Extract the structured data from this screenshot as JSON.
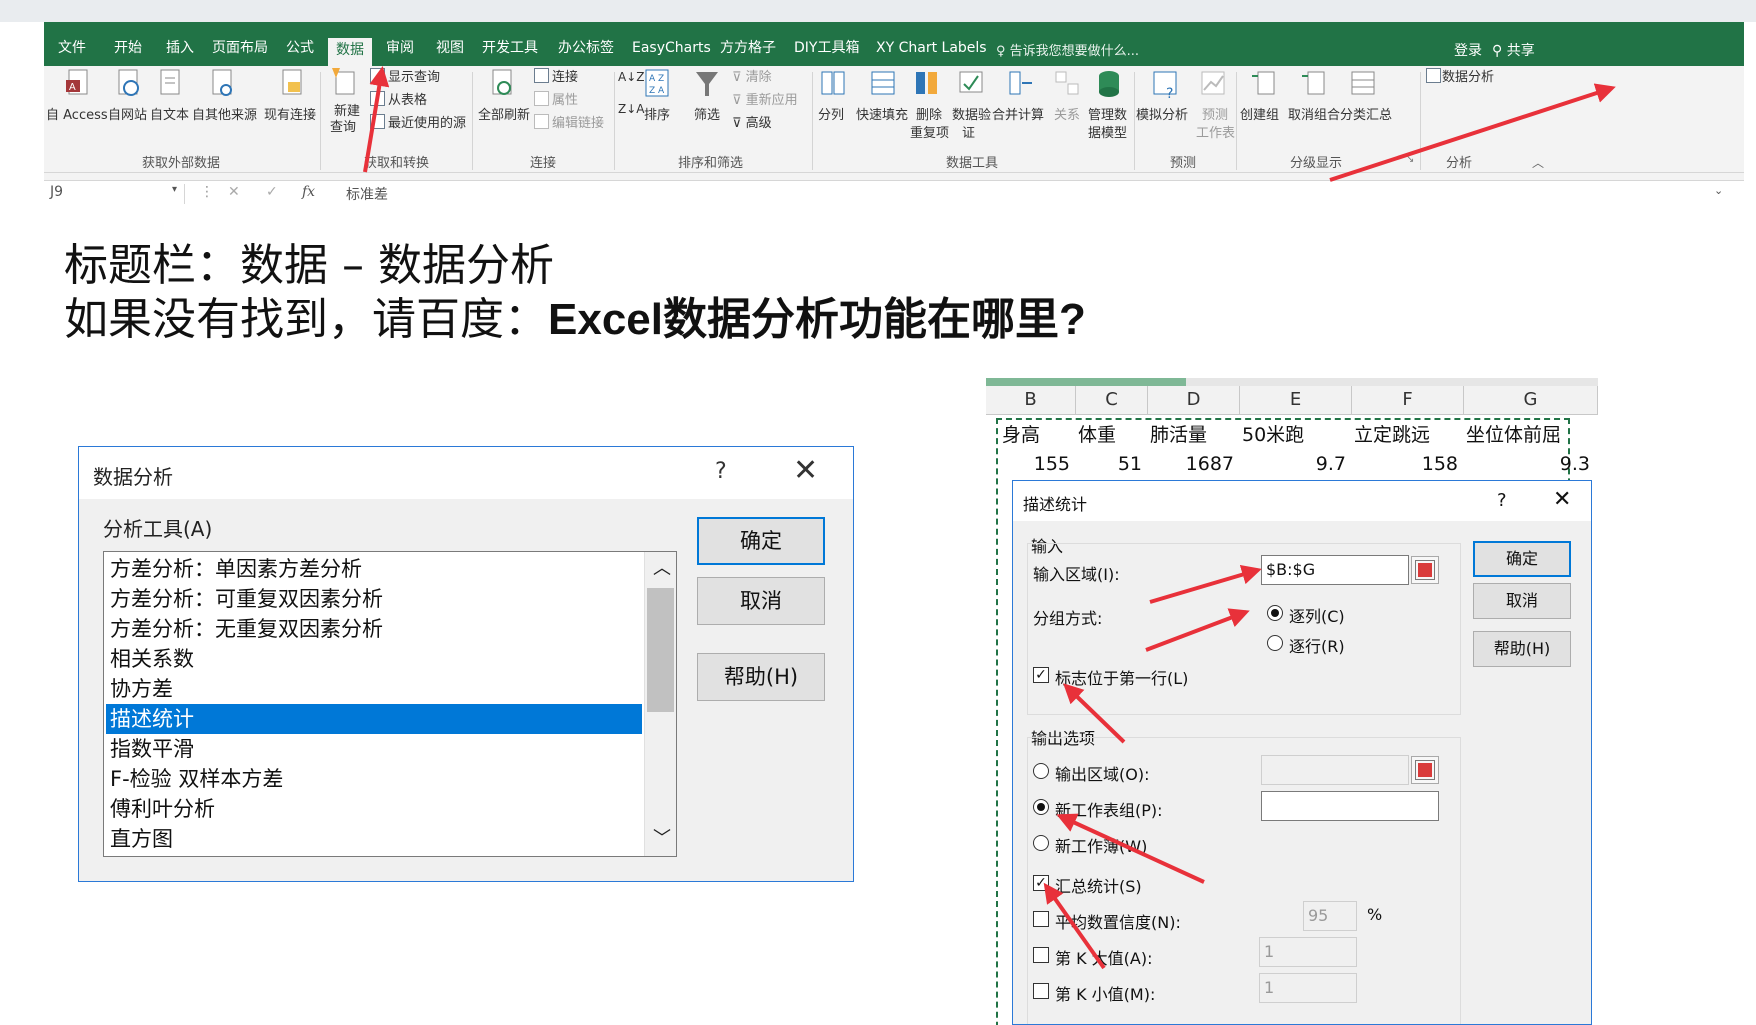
{
  "excel": {
    "tabs": [
      "文件",
      "开始",
      "插入",
      "页面布局",
      "公式",
      "数据",
      "审阅",
      "视图",
      "开发工具",
      "办公标签",
      "EasyCharts",
      "方方格子",
      "DIY工具箱",
      "XY Chart Labels"
    ],
    "tell_me": "告诉我您想要做什么...",
    "login": "登录",
    "share": "共享",
    "ribbon": {
      "ext_items": [
        "自 Access",
        "自网站",
        "自文本",
        "自其他来源",
        "现有连接"
      ],
      "new_query": [
        "新建",
        "查询"
      ],
      "transform_items": [
        "显示查询",
        "从表格",
        "最近使用的源"
      ],
      "refresh_all": "全部刷新",
      "conn_items": [
        "连接",
        "属性",
        "编辑链接"
      ],
      "sort": "排序",
      "filter": "筛选",
      "filter_items": [
        "清除",
        "重新应用",
        "高级"
      ],
      "tool_items": [
        "分列",
        "快速填充",
        "删除",
        "重复项",
        "数据验",
        "证",
        "合并计算",
        "关系",
        "管理数",
        "据模型"
      ],
      "forecast_items": [
        "模拟分析",
        "预测",
        "工作表"
      ],
      "outline_items": [
        "创建组",
        "取消组合",
        "分类汇总"
      ],
      "data_analysis": "数据分析",
      "groups": [
        "获取外部数据",
        "获取和转换",
        "连接",
        "排序和筛选",
        "数据工具",
        "预测",
        "分级显示",
        "分析"
      ]
    },
    "name_box": "J9",
    "formula": "标准差"
  },
  "headings": {
    "line1": "标题栏：数据 – 数据分析",
    "line2_prefix": "如果没有找到，请百度：",
    "line2_bold": "Excel数据分析功能在哪里?"
  },
  "data_analysis_dialog": {
    "title": "数据分析",
    "help_glyph": "?",
    "tools_label": "分析工具(A)",
    "items": [
      "方差分析：单因素方差分析",
      "方差分析：可重复双因素分析",
      "方差分析：无重复双因素分析",
      "相关系数",
      "协方差",
      "描述统计",
      "指数平滑",
      "F-检验 双样本方差",
      "傅利叶分析",
      "直方图"
    ],
    "ok": "确定",
    "cancel": "取消",
    "help": "帮助(H)"
  },
  "sheet": {
    "columns": [
      "B",
      "C",
      "D",
      "E",
      "F",
      "G"
    ],
    "headers": [
      "身高",
      "体重",
      "肺活量",
      "50米跑",
      "立定跳远",
      "坐位体前屈"
    ],
    "row1": [
      "155",
      "51",
      "1687",
      "9.7",
      "158",
      "9.3"
    ]
  },
  "desc_stats_dialog": {
    "title": "描述统计",
    "help_glyph": "?",
    "input_group": "输入",
    "input_range_label": "输入区域(I):",
    "input_range_value": "$B:$G",
    "grouped_by": "分组方式:",
    "by_columns": "逐列(C)",
    "by_rows": "逐行(R)",
    "labels_first_row": "标志位于第一行(L)",
    "output_group": "输出选项",
    "output_range": "输出区域(O):",
    "new_sheet": "新工作表组(P):",
    "new_workbook": "新工作薄(W)",
    "summary_stats": "汇总统计(S)",
    "confidence": "平均数置信度(N):",
    "confidence_value": "95",
    "percent": "%",
    "kth_largest": "第 K 大值(A):",
    "kth_largest_value": "1",
    "kth_smallest": "第 K 小值(M):",
    "kth_smallest_value": "1",
    "ok": "确定",
    "cancel": "取消",
    "help": "帮助(H)",
    "state": {
      "by_columns": true,
      "labels_first_row": true,
      "new_sheet": true,
      "summary_stats": true
    }
  },
  "colors": {
    "excel_green": "#217346",
    "selection": "#0078d7",
    "arrow_red": "#e8313a"
  }
}
